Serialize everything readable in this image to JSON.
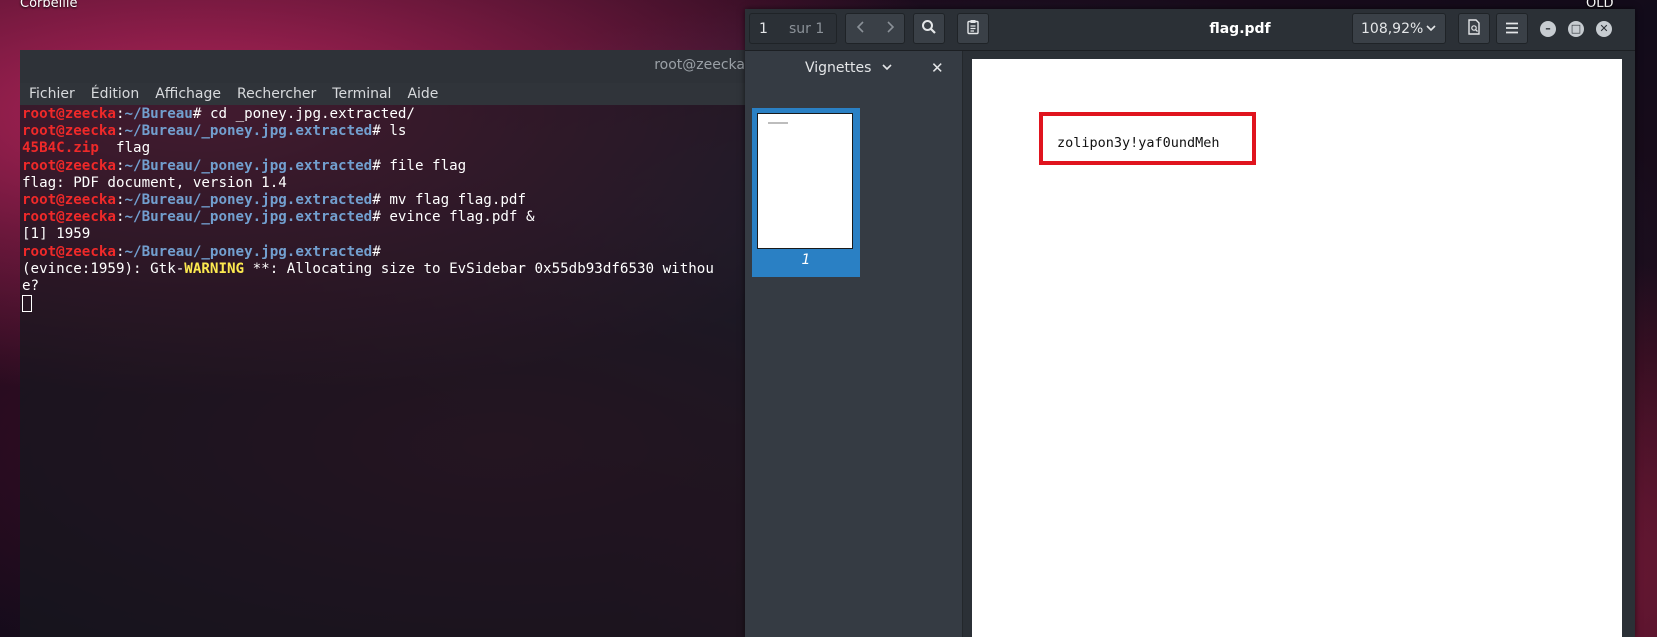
{
  "desktop": {
    "trash_label": "Corbeille",
    "top_right_label": "OLD"
  },
  "terminal": {
    "title": "root@zeecka",
    "menu": [
      "Fichier",
      "Édition",
      "Affichage",
      "Rechercher",
      "Terminal",
      "Aide"
    ],
    "lines": [
      {
        "user": "root@zeecka",
        "sep": ":",
        "path": "~/Bureau",
        "cmd": "# cd _poney.jpg.extracted/"
      },
      {
        "user": "root@zeecka",
        "sep": ":",
        "path": "~/Bureau/_poney.jpg.extracted",
        "cmd": "# ls"
      },
      {
        "zip": "45B4C.zip",
        "text": "  flag"
      },
      {
        "user": "root@zeecka",
        "sep": ":",
        "path": "~/Bureau/_poney.jpg.extracted",
        "cmd": "# file flag"
      },
      {
        "text": "flag: PDF document, version 1.4"
      },
      {
        "user": "root@zeecka",
        "sep": ":",
        "path": "~/Bureau/_poney.jpg.extracted",
        "cmd": "# mv flag flag.pdf"
      },
      {
        "user": "root@zeecka",
        "sep": ":",
        "path": "~/Bureau/_poney.jpg.extracted",
        "cmd": "# evince flag.pdf &"
      },
      {
        "text": "[1] 1959"
      },
      {
        "user": "root@zeecka",
        "sep": ":",
        "path": "~/Bureau/_poney.jpg.extracted",
        "cmd": "#"
      },
      {
        "pre": "(evince:1959): Gtk-",
        "warn": "WARNING",
        "post": " **: Allocating size to EvSidebar 0x55db93df6530 withou"
      },
      {
        "text": "e?"
      }
    ]
  },
  "evince": {
    "page_current": "1",
    "page_of": "sur 1",
    "title": "flag.pdf",
    "zoom": "108,92%",
    "sidebar_label": "Vignettes",
    "thumb_page_number": "1",
    "flag_text": "zolipon3y!yaf0undMeh",
    "icons": {
      "prev": "chevron-left-icon",
      "next": "chevron-right-icon",
      "search": "search-icon",
      "annotations": "clipboard-icon",
      "document": "document-icon",
      "menu": "hamburger-menu-icon"
    },
    "colors": {
      "highlight_box": "#e0141e",
      "thumb_selection": "#2a80c4"
    }
  }
}
